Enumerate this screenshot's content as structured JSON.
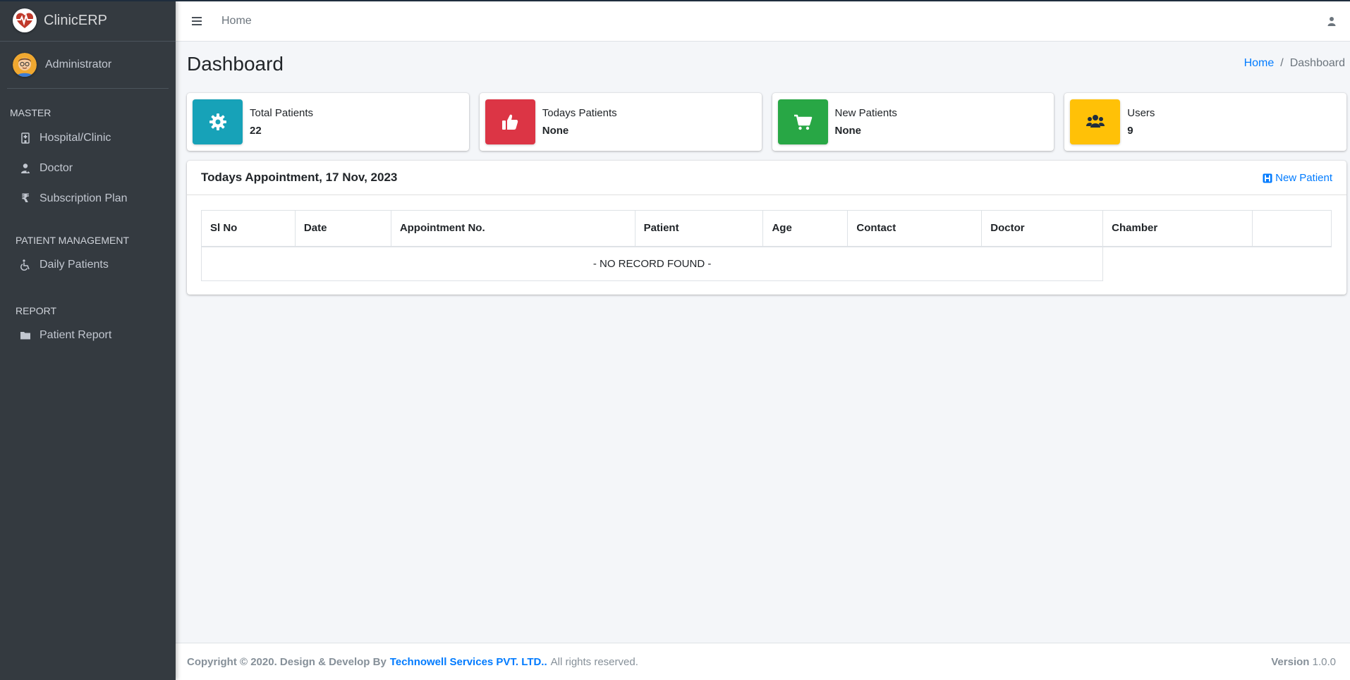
{
  "brand": {
    "name": "ClinicERP"
  },
  "user": {
    "name": "Administrator"
  },
  "sidebar": {
    "sections": [
      {
        "header": "MASTER",
        "items": [
          {
            "label": "Hospital/Clinic",
            "icon": "hospital-icon"
          },
          {
            "label": "Doctor",
            "icon": "doctor-icon"
          },
          {
            "label": "Subscription Plan",
            "icon": "rupee-icon"
          }
        ]
      },
      {
        "header": "PATIENT MANAGEMENT",
        "items": [
          {
            "label": "Daily Patients",
            "icon": "wheelchair-icon"
          }
        ]
      },
      {
        "header": "REPORT",
        "items": [
          {
            "label": "Patient Report",
            "icon": "folder-icon"
          }
        ]
      }
    ]
  },
  "navbar": {
    "home": "Home"
  },
  "page": {
    "title": "Dashboard"
  },
  "breadcrumb": {
    "home": "Home",
    "separator": "/",
    "current": "Dashboard"
  },
  "info_boxes": [
    {
      "label": "Total Patients",
      "value": "22",
      "color": "#17a2b8",
      "icon": "gear-icon"
    },
    {
      "label": "Todays Patients",
      "value": "None",
      "color": "#dc3545",
      "icon": "thumbs-up-icon"
    },
    {
      "label": "New Patients",
      "value": "None",
      "color": "#28a745",
      "icon": "cart-icon"
    },
    {
      "label": "Users",
      "value": "9",
      "color": "#ffc107",
      "icon": "users-icon"
    }
  ],
  "appointments": {
    "title": "Todays Appointment, 17 Nov, 2023",
    "new_patient_label": "New Patient",
    "columns": [
      "Sl No",
      "Date",
      "Appointment No.",
      "Patient",
      "Age",
      "Contact",
      "Doctor",
      "Chamber",
      ""
    ],
    "empty_message": "- NO RECORD FOUND -"
  },
  "footer": {
    "copyright": "Copyright © 2020. Design & Develop By",
    "company": "Technowell Services PVT. LTD..",
    "rights": "All rights reserved.",
    "version_label": "Version",
    "version": "1.0.0"
  }
}
